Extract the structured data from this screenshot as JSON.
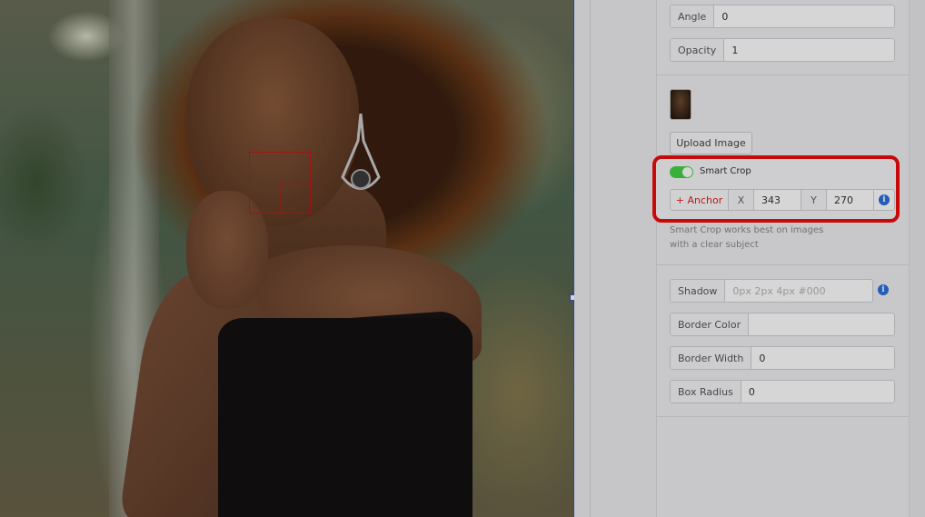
{
  "properties": {
    "angle": {
      "label": "Angle",
      "value": "0"
    },
    "opacity": {
      "label": "Opacity",
      "value": "1"
    }
  },
  "image": {
    "upload_label": "Upload Image"
  },
  "smart_crop": {
    "toggle_label": "Smart Crop",
    "enabled": true,
    "anchor_label": "+ Anchor",
    "x_label": "X",
    "x_value": "343",
    "y_label": "Y",
    "y_value": "270",
    "helper_text": "Smart Crop works best on images with a clear subject"
  },
  "style": {
    "shadow": {
      "label": "Shadow",
      "placeholder": "0px 2px 4px #000"
    },
    "border_color": {
      "label": "Border Color",
      "value": ""
    },
    "border_width": {
      "label": "Border Width",
      "value": "0"
    },
    "box_radius": {
      "label": "Box Radius",
      "value": "0"
    }
  },
  "colors": {
    "highlight": "#ee0b0b",
    "toggle_on": "#46d247",
    "info": "#2a6fd8",
    "anchor_text": "#e02020"
  }
}
